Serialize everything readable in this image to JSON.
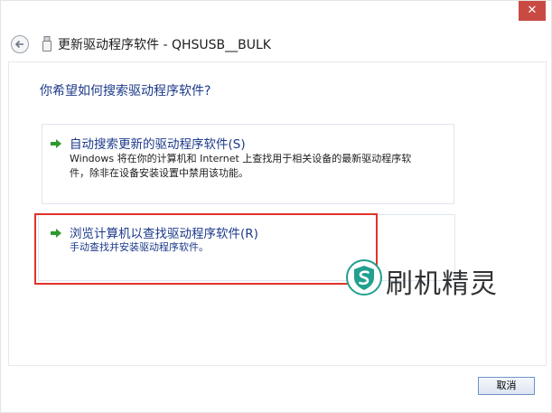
{
  "window": {
    "close_glyph": "✕",
    "title": "更新驱动程序软件 - QHSUSB__BULK"
  },
  "main": {
    "heading": "你希望如何搜索驱动程序软件?",
    "options": [
      {
        "icon": "green-arrow-icon",
        "title": "自动搜索更新的驱动程序软件(S)",
        "desc_line1": "Windows 将在你的计算机和 Internet 上查找用于相关设备的最新驱动程序软",
        "desc_line2": "件，除非在设备安装设置中禁用该功能。"
      },
      {
        "icon": "green-arrow-icon",
        "title": "浏览计算机以查找驱动程序软件(R)",
        "desc_line1": "手动查找并安装驱动程序软件。"
      }
    ]
  },
  "watermark": {
    "text": "刷机精灵",
    "icon": "shield-s-icon"
  },
  "footer": {
    "cancel_label": "取消"
  },
  "colors": {
    "link_blue": "#1c3a8a",
    "close_red": "#c94a43",
    "highlight_red": "#e0332b",
    "arrow_green": "#2e9a2e",
    "watermark_teal": "#21a08f"
  }
}
